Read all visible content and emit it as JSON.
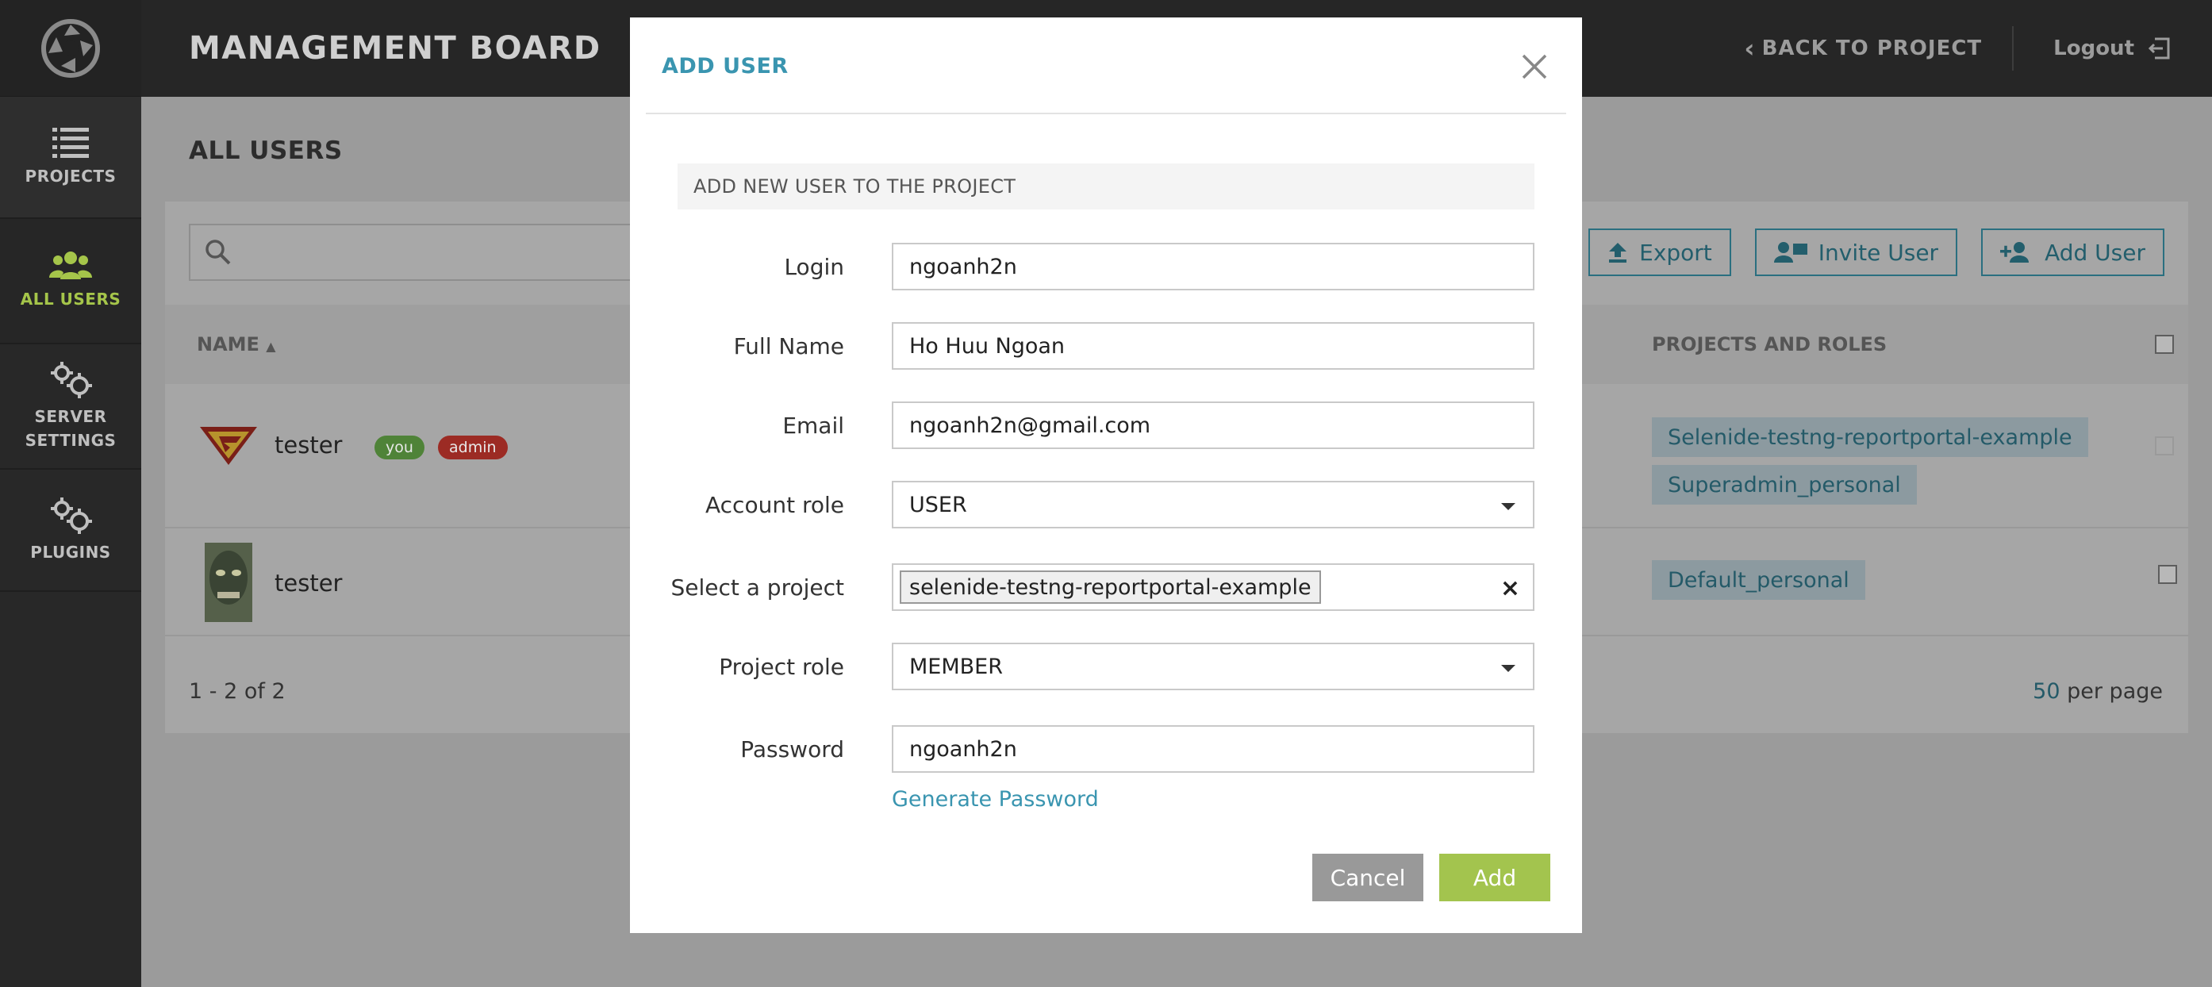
{
  "header": {
    "title": "MANAGEMENT BOARD",
    "back_label": "BACK TO PROJECT",
    "logout_label": "Logout"
  },
  "sidebar": {
    "items": [
      {
        "label": "PROJECTS",
        "icon": "list-icon"
      },
      {
        "label": "ALL USERS",
        "icon": "users-icon",
        "active": true
      },
      {
        "label": "SERVER SETTINGS",
        "icon": "gears-icon"
      },
      {
        "label": "PLUGINS",
        "icon": "gears-icon"
      }
    ]
  },
  "page": {
    "title": "ALL USERS",
    "search_placeholder": "",
    "buttons": {
      "export": "Export",
      "invite": "Invite User",
      "add": "Add User"
    },
    "columns": {
      "name": "NAME",
      "roles": "PROJECTS AND ROLES"
    },
    "rows": [
      {
        "name": "tester",
        "badges": [
          "you",
          "admin"
        ],
        "projects": [
          "Selenide-testng-reportportal-example",
          "Superadmin_personal"
        ]
      },
      {
        "name": "tester",
        "badges": [],
        "projects": [
          "Default_personal"
        ]
      }
    ],
    "pagination": {
      "range": "1 - 2 of 2",
      "per_page_value": "50",
      "per_page_label": "per page"
    }
  },
  "modal": {
    "title": "ADD USER",
    "subtitle": "ADD NEW USER TO THE PROJECT",
    "fields": {
      "login": {
        "label": "Login",
        "value": "ngoanh2n"
      },
      "full_name": {
        "label": "Full Name",
        "value": "Ho Huu Ngoan"
      },
      "email": {
        "label": "Email",
        "value": "ngoanh2n@gmail.com"
      },
      "account_role": {
        "label": "Account role",
        "value": "USER"
      },
      "project": {
        "label": "Select a project",
        "value": "selenide-testng-reportportal-example",
        "clear": "×"
      },
      "project_role": {
        "label": "Project role",
        "value": "MEMBER"
      },
      "password": {
        "label": "Password",
        "value": "ngoanh2n"
      }
    },
    "generate_password": "Generate Password",
    "cancel_label": "Cancel",
    "add_label": "Add"
  },
  "colors": {
    "accent": "#3a95b0",
    "add_button": "#a3c44e",
    "active_nav": "#a5c54a",
    "badge_you": "#4f8338",
    "badge_admin": "#9c2b24"
  }
}
